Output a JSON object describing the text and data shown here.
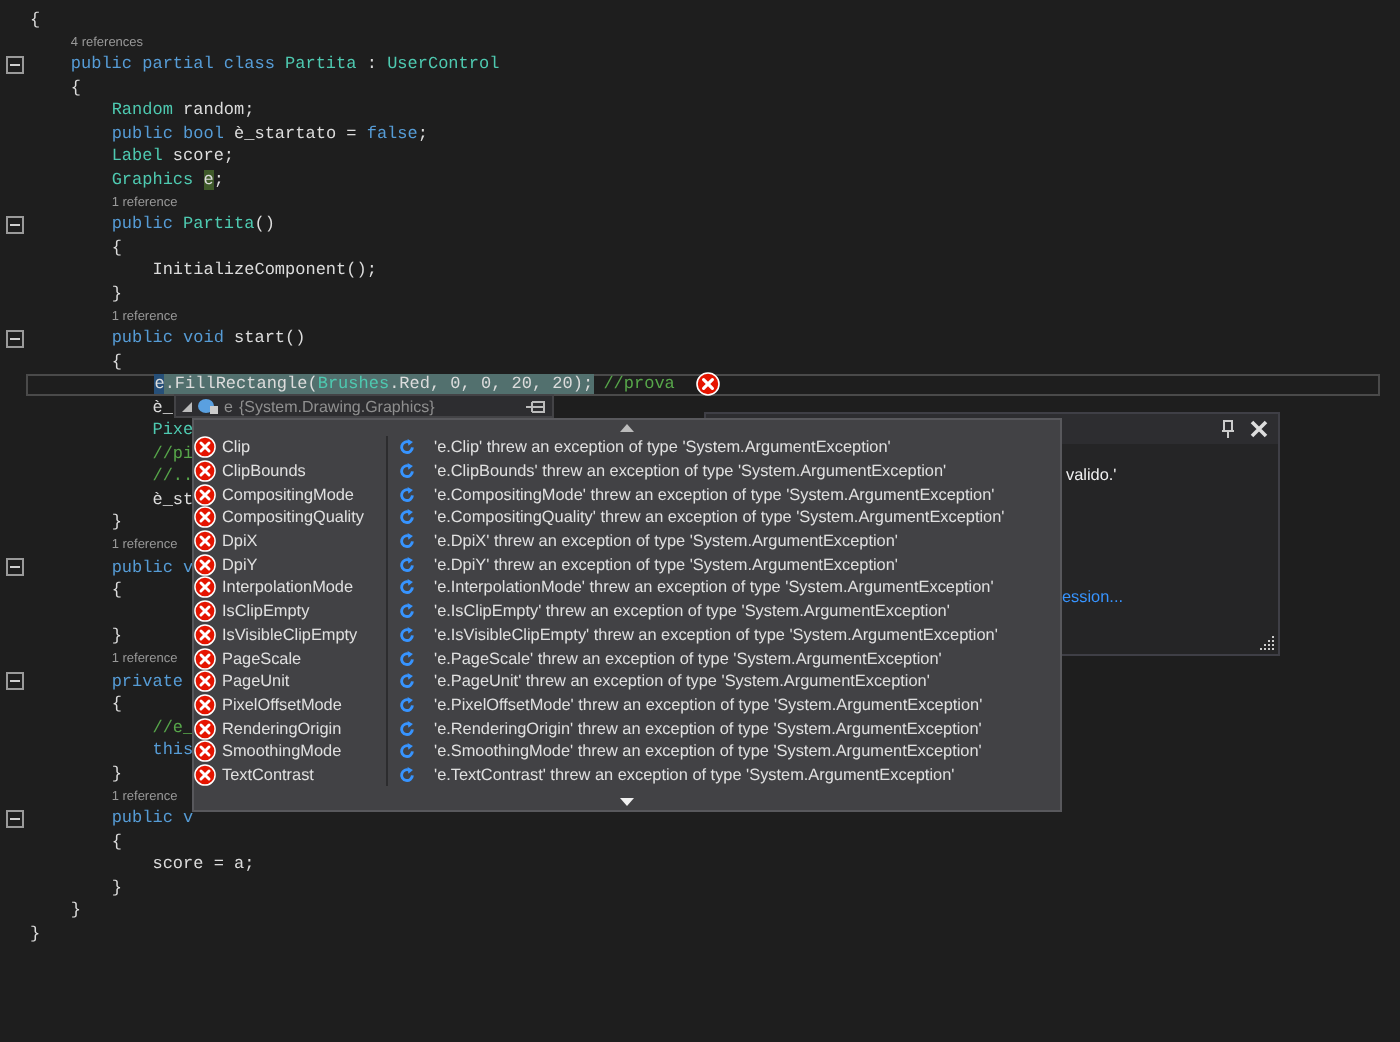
{
  "editor": {
    "lines": [
      {
        "kind": "code",
        "collapsible": false,
        "current": false,
        "tokens": [
          {
            "kind": "plain",
            "text": "{"
          }
        ]
      },
      {
        "kind": "lens",
        "text": "4 references"
      },
      {
        "kind": "code",
        "collapsible": true,
        "current": false,
        "tokens": [
          {
            "kind": "keyword",
            "text": "    public partial class "
          },
          {
            "kind": "type",
            "text": "Partita"
          },
          {
            "kind": "plain",
            "text": " : "
          },
          {
            "kind": "type",
            "text": "UserControl"
          }
        ]
      },
      {
        "kind": "code",
        "collapsible": false,
        "current": false,
        "tokens": [
          {
            "kind": "plain",
            "text": "    {"
          }
        ]
      },
      {
        "kind": "code",
        "collapsible": false,
        "current": false,
        "tokens": [
          {
            "kind": "type",
            "text": "        Random"
          },
          {
            "kind": "plain",
            "text": " random;"
          }
        ]
      },
      {
        "kind": "code",
        "collapsible": false,
        "current": false,
        "tokens": [
          {
            "kind": "keyword",
            "text": "        public bool "
          },
          {
            "kind": "plain",
            "text": "è_startato = "
          },
          {
            "kind": "keyword",
            "text": "false"
          },
          {
            "kind": "plain",
            "text": ";"
          }
        ]
      },
      {
        "kind": "code",
        "collapsible": false,
        "current": false,
        "tokens": [
          {
            "kind": "type",
            "text": "        Label"
          },
          {
            "kind": "plain",
            "text": " score;"
          }
        ]
      },
      {
        "kind": "code",
        "collapsible": false,
        "current": false,
        "tokens": [
          {
            "kind": "type",
            "text": "        Graphics "
          },
          {
            "kind": "plain_reference",
            "text": "e"
          },
          {
            "kind": "plain",
            "text": ";"
          }
        ]
      },
      {
        "kind": "lens",
        "text": "1 reference"
      },
      {
        "kind": "code",
        "collapsible": true,
        "current": false,
        "tokens": [
          {
            "kind": "keyword",
            "text": "        public "
          },
          {
            "kind": "type",
            "text": "Partita"
          },
          {
            "kind": "plain",
            "text": "()"
          }
        ]
      },
      {
        "kind": "code",
        "collapsible": false,
        "current": false,
        "tokens": [
          {
            "kind": "plain",
            "text": "        {"
          }
        ]
      },
      {
        "kind": "code",
        "collapsible": false,
        "current": false,
        "tokens": [
          {
            "kind": "plain",
            "text": "            InitializeComponent();"
          }
        ]
      },
      {
        "kind": "code",
        "collapsible": false,
        "current": false,
        "tokens": [
          {
            "kind": "plain",
            "text": "        }"
          }
        ]
      },
      {
        "kind": "lens",
        "text": "1 reference"
      },
      {
        "kind": "code",
        "collapsible": true,
        "current": false,
        "tokens": [
          {
            "kind": "keyword",
            "text": "        public void "
          },
          {
            "kind": "plain",
            "text": "start()"
          }
        ]
      },
      {
        "kind": "code",
        "collapsible": false,
        "current": false,
        "tokens": [
          {
            "kind": "plain",
            "text": "        {"
          }
        ]
      },
      {
        "kind": "code",
        "collapsible": false,
        "current": true,
        "tokens": [
          {
            "kind": "plain_selection",
            "text": "            e"
          },
          {
            "kind": "plain_statement",
            "text": ".FillRectangle("
          },
          {
            "kind": "type_statement",
            "text": "Brushes"
          },
          {
            "kind": "plain_statement",
            "text": ".Red, 0, 0, 20, 20);"
          },
          {
            "kind": "comment",
            "text": " //prova"
          }
        ]
      },
      {
        "kind": "code",
        "collapsible": false,
        "current": false,
        "tokens": [
          {
            "kind": "plain",
            "text": "            è_"
          }
        ]
      },
      {
        "kind": "code",
        "collapsible": false,
        "current": false,
        "tokens": [
          {
            "kind": "type",
            "text": "            Pixe"
          }
        ]
      },
      {
        "kind": "code",
        "collapsible": false,
        "current": false,
        "tokens": [
          {
            "kind": "comment",
            "text": "            //pi"
          }
        ]
      },
      {
        "kind": "code",
        "collapsible": false,
        "current": false,
        "tokens": [
          {
            "kind": "comment",
            "text": "            //.."
          }
        ]
      },
      {
        "kind": "code",
        "collapsible": false,
        "current": false,
        "tokens": [
          {
            "kind": "plain",
            "text": "            è_st"
          }
        ]
      },
      {
        "kind": "code",
        "collapsible": false,
        "current": false,
        "tokens": [
          {
            "kind": "plain",
            "text": "        }"
          }
        ]
      },
      {
        "kind": "lens",
        "text": "1 reference"
      },
      {
        "kind": "code",
        "collapsible": true,
        "current": false,
        "tokens": [
          {
            "kind": "keyword",
            "text": "        public v"
          }
        ]
      },
      {
        "kind": "code",
        "collapsible": false,
        "current": false,
        "tokens": [
          {
            "kind": "plain",
            "text": "        {"
          }
        ]
      },
      {
        "kind": "blank"
      },
      {
        "kind": "code",
        "collapsible": false,
        "current": false,
        "tokens": [
          {
            "kind": "plain",
            "text": "        }"
          }
        ]
      },
      {
        "kind": "lens",
        "text": "1 reference"
      },
      {
        "kind": "code",
        "collapsible": true,
        "current": false,
        "tokens": [
          {
            "kind": "keyword",
            "text": "        private"
          }
        ]
      },
      {
        "kind": "code",
        "collapsible": false,
        "current": false,
        "tokens": [
          {
            "kind": "plain",
            "text": "        {"
          }
        ]
      },
      {
        "kind": "code",
        "collapsible": false,
        "current": false,
        "tokens": [
          {
            "kind": "comment",
            "text": "            //e_"
          }
        ]
      },
      {
        "kind": "code",
        "collapsible": false,
        "current": false,
        "tokens": [
          {
            "kind": "keyword",
            "text": "            this"
          }
        ]
      },
      {
        "kind": "code",
        "collapsible": false,
        "current": false,
        "tokens": [
          {
            "kind": "plain",
            "text": "        }"
          }
        ]
      },
      {
        "kind": "lens",
        "text": "1 reference"
      },
      {
        "kind": "code",
        "collapsible": true,
        "current": false,
        "tokens": [
          {
            "kind": "keyword",
            "text": "        public v"
          }
        ]
      },
      {
        "kind": "code",
        "collapsible": false,
        "current": false,
        "tokens": [
          {
            "kind": "plain",
            "text": "        {"
          }
        ]
      },
      {
        "kind": "code",
        "collapsible": false,
        "current": false,
        "tokens": [
          {
            "kind": "plain",
            "text": "            score = a;"
          }
        ]
      },
      {
        "kind": "code",
        "collapsible": false,
        "current": false,
        "tokens": [
          {
            "kind": "plain",
            "text": "        }"
          }
        ]
      },
      {
        "kind": "code",
        "collapsible": false,
        "current": false,
        "tokens": [
          {
            "kind": "plain",
            "text": "    }"
          }
        ]
      },
      {
        "kind": "code",
        "collapsible": false,
        "current": false,
        "tokens": [
          {
            "kind": "plain",
            "text": "}"
          }
        ]
      }
    ]
  },
  "datatip": {
    "header": {
      "name": "e",
      "type": "{System.Drawing.Graphics}"
    },
    "rows": [
      {
        "name": "Clip",
        "value": "'e.Clip' threw an exception of type 'System.ArgumentException'"
      },
      {
        "name": "ClipBounds",
        "value": "'e.ClipBounds' threw an exception of type 'System.ArgumentException'"
      },
      {
        "name": "CompositingMode",
        "value": "'e.CompositingMode' threw an exception of type 'System.ArgumentException'"
      },
      {
        "name": "CompositingQuality",
        "value": "'e.CompositingQuality' threw an exception of type 'System.ArgumentException'"
      },
      {
        "name": "DpiX",
        "value": "'e.DpiX' threw an exception of type 'System.ArgumentException'"
      },
      {
        "name": "DpiY",
        "value": "'e.DpiY' threw an exception of type 'System.ArgumentException'"
      },
      {
        "name": "InterpolationMode",
        "value": "'e.InterpolationMode' threw an exception of type 'System.ArgumentException'"
      },
      {
        "name": "IsClipEmpty",
        "value": "'e.IsClipEmpty' threw an exception of type 'System.ArgumentException'"
      },
      {
        "name": "IsVisibleClipEmpty",
        "value": "'e.IsVisibleClipEmpty' threw an exception of type 'System.ArgumentException'"
      },
      {
        "name": "PageScale",
        "value": "'e.PageScale' threw an exception of type 'System.ArgumentException'"
      },
      {
        "name": "PageUnit",
        "value": "'e.PageUnit' threw an exception of type 'System.ArgumentException'"
      },
      {
        "name": "PixelOffsetMode",
        "value": "'e.PixelOffsetMode' threw an exception of type 'System.ArgumentException'"
      },
      {
        "name": "RenderingOrigin",
        "value": "'e.RenderingOrigin' threw an exception of type 'System.ArgumentException'"
      },
      {
        "name": "SmoothingMode",
        "value": "'e.SmoothingMode' threw an exception of type 'System.ArgumentException'"
      },
      {
        "name": "TextContrast",
        "value": "'e.TextContrast' threw an exception of type 'System.ArgumentException'"
      }
    ]
  },
  "exception_panel": {
    "message_fragment": "valido.'",
    "link_fragment": "ession..."
  }
}
